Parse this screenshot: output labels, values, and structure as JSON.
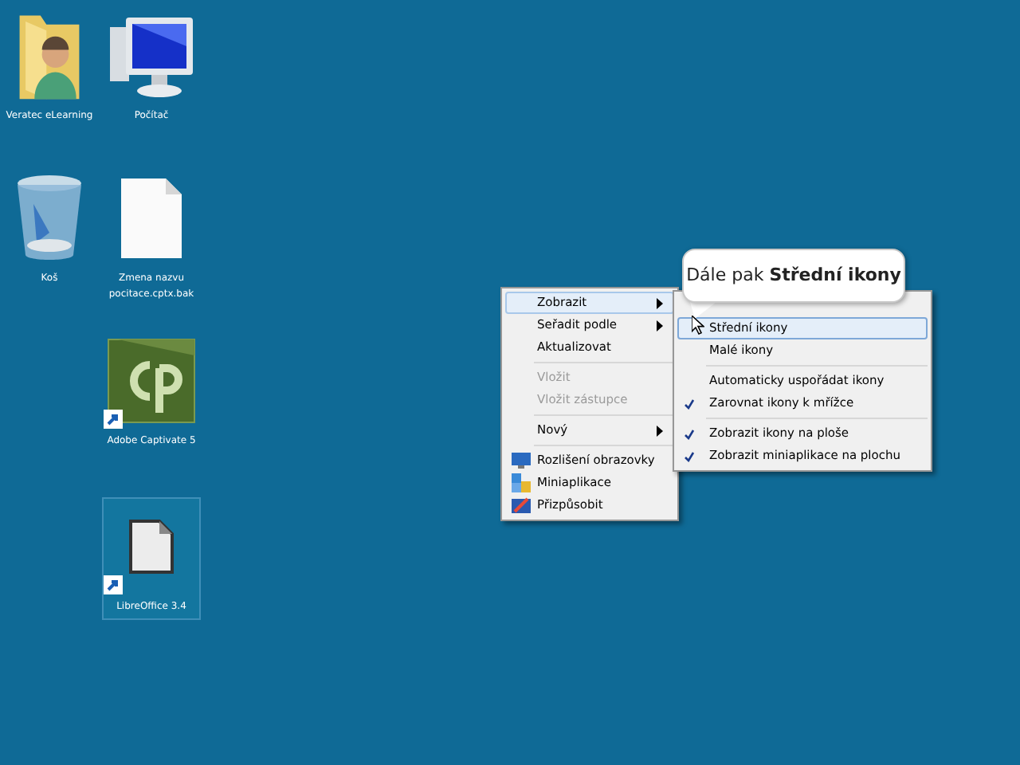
{
  "desktop_icons": [
    {
      "kind": "user-folder",
      "label": "Veratec eLearning",
      "shortcut": false,
      "selected": false
    },
    {
      "kind": "computer",
      "label": "Počítač",
      "shortcut": false,
      "selected": false
    },
    {
      "kind": "recycle-bin",
      "label": "Koš",
      "shortcut": false,
      "selected": false
    },
    {
      "kind": "document",
      "label": "Zmena nazvu pocitace.cptx.bak",
      "shortcut": false,
      "selected": false
    },
    {
      "kind": "captivate",
      "label": "Adobe Captivate 5",
      "shortcut": true,
      "selected": false
    },
    {
      "kind": "libreoffice",
      "label": "LibreOffice 3.4",
      "shortcut": true,
      "selected": true
    }
  ],
  "context_menu": {
    "items": [
      {
        "kind": "item",
        "label": "Zobrazit",
        "submenu": true,
        "disabled": false,
        "selected": true
      },
      {
        "kind": "item",
        "label": "Seřadit podle",
        "submenu": true,
        "disabled": false,
        "selected": false
      },
      {
        "kind": "item",
        "label": "Aktualizovat",
        "submenu": false,
        "disabled": false,
        "selected": false
      },
      {
        "kind": "separator"
      },
      {
        "kind": "item",
        "label": "Vložit",
        "submenu": false,
        "disabled": true,
        "selected": false
      },
      {
        "kind": "item",
        "label": "Vložit zástupce",
        "submenu": false,
        "disabled": true,
        "selected": false
      },
      {
        "kind": "separator"
      },
      {
        "kind": "item",
        "label": "Nový",
        "submenu": true,
        "disabled": false,
        "selected": false
      },
      {
        "kind": "separator"
      },
      {
        "kind": "item",
        "label": "Rozlišení obrazovky",
        "submenu": false,
        "disabled": false,
        "selected": false
      },
      {
        "kind": "item",
        "label": "Miniaplikace",
        "submenu": false,
        "disabled": false,
        "selected": false
      },
      {
        "kind": "item",
        "label": "Přizpůsobit",
        "submenu": false,
        "disabled": false,
        "selected": false
      }
    ]
  },
  "submenu": {
    "items": [
      {
        "kind": "hidden"
      },
      {
        "kind": "item",
        "label": "Střední ikony",
        "checked": false,
        "selected": true
      },
      {
        "kind": "item",
        "label": "Malé ikony",
        "checked": false,
        "selected": false
      },
      {
        "kind": "separator"
      },
      {
        "kind": "item",
        "label": "Automaticky uspořádat ikony",
        "checked": false,
        "selected": false
      },
      {
        "kind": "item",
        "label": "Zarovnat ikony k mřížce",
        "checked": true,
        "selected": false
      },
      {
        "kind": "separator"
      },
      {
        "kind": "item",
        "label": "Zobrazit ikony na ploše",
        "checked": true,
        "selected": false
      },
      {
        "kind": "item",
        "label": "Zobrazit miniaplikace na plochu",
        "checked": true,
        "selected": false
      }
    ]
  },
  "callout": {
    "text": "Dále pak **Střední ikony**"
  }
}
